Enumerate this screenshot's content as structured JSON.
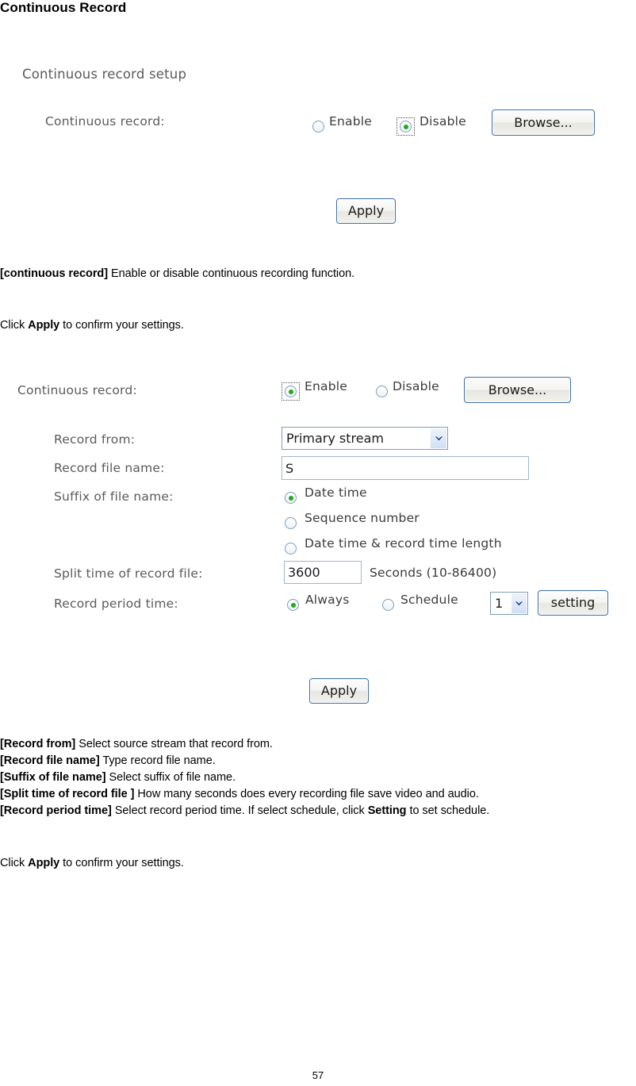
{
  "document": {
    "title": "Continuous Record",
    "page_number": "57"
  },
  "panel1": {
    "heading": "Continuous record setup",
    "row_label": "Continuous record:",
    "enable_label": "Enable",
    "disable_label": "Disable",
    "selected": "Disable",
    "browse_label": "Browse...",
    "apply_label": "Apply"
  },
  "notes1": {
    "line1_bold": "[continuous record]",
    "line1_rest": " Enable or disable continuous recording function.",
    "line2_pre": "Click ",
    "line2_bold": "Apply",
    "line2_post": " to confirm your settings."
  },
  "panel2": {
    "record_label": "Continuous record:",
    "enable_label": "Enable",
    "disable_label": "Disable",
    "selected": "Enable",
    "browse_label": "Browse...",
    "record_from_label": "Record from:",
    "record_from_value": "Primary stream",
    "record_file_name_label": "Record file name:",
    "record_file_name_value": "S",
    "suffix_label": "Suffix of file name:",
    "suffix_options": [
      {
        "label": "Date time",
        "checked": true
      },
      {
        "label": "Sequence number",
        "checked": false
      },
      {
        "label": "Date time & record time length",
        "checked": false
      }
    ],
    "split_time_label": "Split time of record file:",
    "split_time_value": "3600",
    "split_time_units": "Seconds (10-86400)",
    "record_period_label": "Record period time:",
    "always_label": "Always",
    "schedule_label": "Schedule",
    "schedule_value": "1",
    "setting_label": "setting",
    "apply_label": "Apply"
  },
  "notes2": {
    "lines": [
      {
        "bold": "[Record from]",
        "rest": " Select source stream that record from."
      },
      {
        "bold": "[Record file name]",
        "rest": " Type record file name."
      },
      {
        "bold": "[Suffix of file name]",
        "rest": " Select suffix of file name."
      },
      {
        "bold": "[Split time of record file ]",
        "rest": " How many seconds does every recording file save video and audio."
      }
    ],
    "last_line": {
      "bold": "[Record period time]",
      "mid": " Select record period time. If select schedule, click ",
      "bold2": "Setting",
      "end": " to set schedule."
    },
    "closing_pre": "Click ",
    "closing_bold": "Apply",
    "closing_post": " to confirm your settings."
  },
  "icons": {
    "chevron_down": "chevron-down-icon"
  },
  "colors": {
    "radio_dot": "#1faa1f",
    "button_border": "#3a6ea5",
    "input_border": "#9fb6cd"
  }
}
